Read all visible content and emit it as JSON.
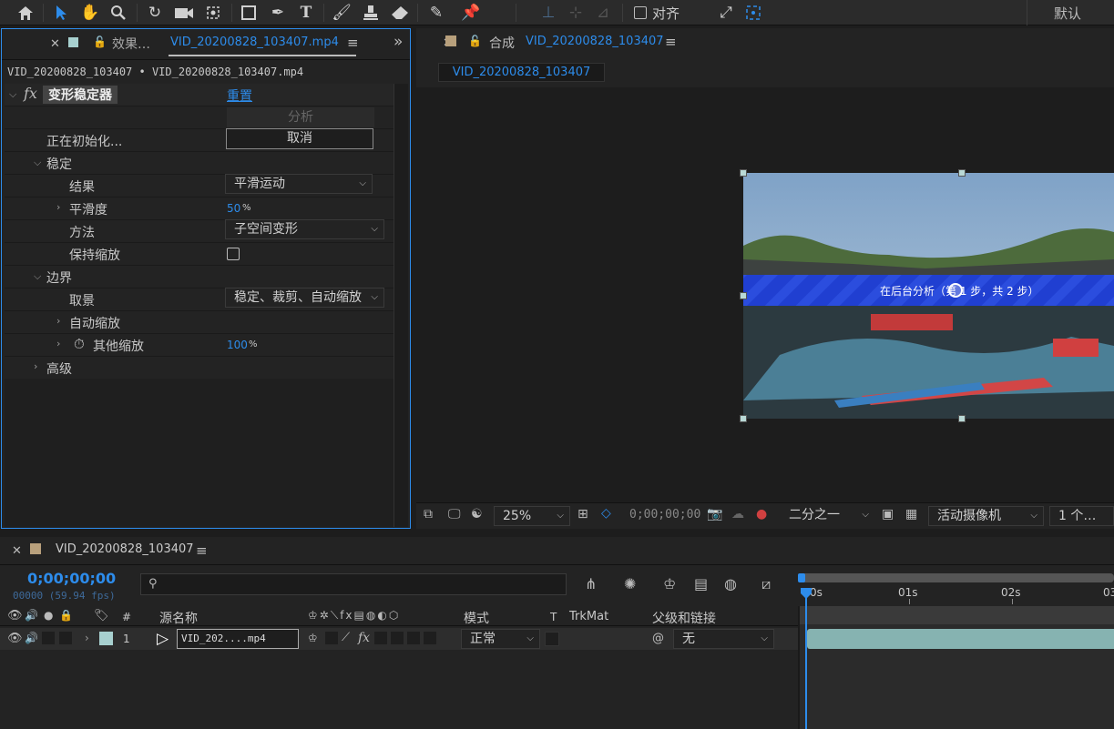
{
  "toolbar": {
    "align_label": "对齐",
    "workspace": "默认"
  },
  "effects_panel": {
    "tab_inactive": "效果…",
    "tab_active": "VID_20200828_103407.mp4",
    "breadcrumb": "VID_20200828_103407 • VID_20200828_103407.mp4",
    "effect_name": "变形稳定器",
    "fx": "fx",
    "reset": "重置",
    "analyze": "分析",
    "status": "正在初始化...",
    "cancel": "取消",
    "stabilize": "稳定",
    "result_label": "结果",
    "result_value": "平滑运动",
    "smoothness_label": "平滑度",
    "smoothness_value": "50",
    "smoothness_unit": "%",
    "method_label": "方法",
    "method_value": "子空间变形",
    "keep_scale_label": "保持缩放",
    "borders": "边界",
    "framing_label": "取景",
    "framing_value": "稳定、裁剪、自动缩放",
    "auto_scale": "自动缩放",
    "other_scale_label": "其他缩放",
    "other_scale_value": "100",
    "other_scale_unit": "%",
    "advanced": "高级"
  },
  "comp_panel": {
    "tab_prefix": "合成",
    "tab_name": "VID_20200828_103407",
    "subtab": "VID_20200828_103407",
    "overlay_text": "在后台分析（第 1 步，共 2 步）",
    "zoom": "25%",
    "timecode": "0;00;00;00",
    "resolution": "二分之一",
    "camera": "活动摄像机",
    "views": "1 个…"
  },
  "timeline": {
    "tab_name": "VID_20200828_103407",
    "timecode": "0;00;00;00",
    "frame_info": "00000 (59.94 fps)",
    "col_num": "#",
    "col_source": "源名称",
    "col_mode": "模式",
    "col_t": "T",
    "col_trkmat": "TrkMat",
    "col_parent": "父级和链接",
    "ruler": [
      "0s",
      "01s",
      "02s",
      "03"
    ],
    "layer": {
      "num": "1",
      "name": "VID_202....mp4",
      "mode": "正常",
      "parent": "无",
      "fx": "fx"
    }
  },
  "colors": {
    "accent": "#2d8ceb",
    "overlay": "#1f3fd9",
    "label_teal": "#a7d0cf",
    "clip": "#86b3b1"
  }
}
